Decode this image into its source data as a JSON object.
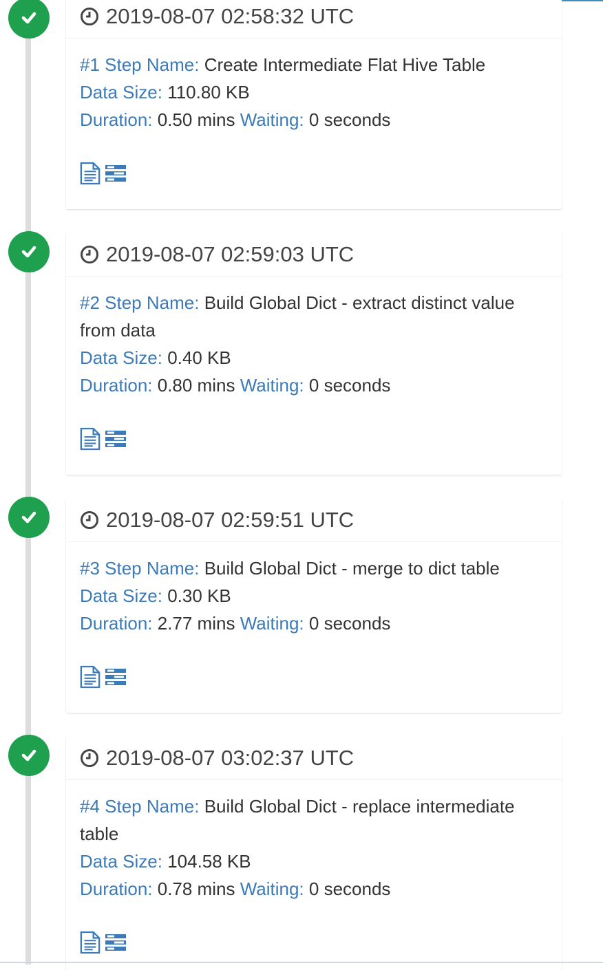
{
  "colors": {
    "accent": "#3c7bb7",
    "success": "#1ea04f",
    "timeline": "#dddddd",
    "text": "#333333"
  },
  "icons": {
    "marker": "check-icon",
    "time": "clock-icon",
    "log": "log-file-icon",
    "params": "parameters-icon"
  },
  "labels": {
    "step_name": "Step Name:",
    "data_size": "Data Size:",
    "duration": "Duration:",
    "waiting": "Waiting:"
  },
  "steps": [
    {
      "timestamp": "2019-08-07 02:58:32 UTC",
      "number": "#1",
      "name": "Create Intermediate Flat Hive Table",
      "data_size": "110.80 KB",
      "duration": "0.50 mins",
      "waiting": "0 seconds"
    },
    {
      "timestamp": "2019-08-07 02:59:03 UTC",
      "number": "#2",
      "name": "Build Global Dict - extract distinct value from data",
      "data_size": "0.40 KB",
      "duration": "0.80 mins",
      "waiting": "0 seconds"
    },
    {
      "timestamp": "2019-08-07 02:59:51 UTC",
      "number": "#3",
      "name": "Build Global Dict - merge to dict table",
      "data_size": "0.30 KB",
      "duration": "2.77 mins",
      "waiting": "0 seconds"
    },
    {
      "timestamp": "2019-08-07 03:02:37 UTC",
      "number": "#4",
      "name": "Build Global Dict - replace intermediate table",
      "data_size": "104.58 KB",
      "duration": "0.78 mins",
      "waiting": "0 seconds"
    }
  ]
}
